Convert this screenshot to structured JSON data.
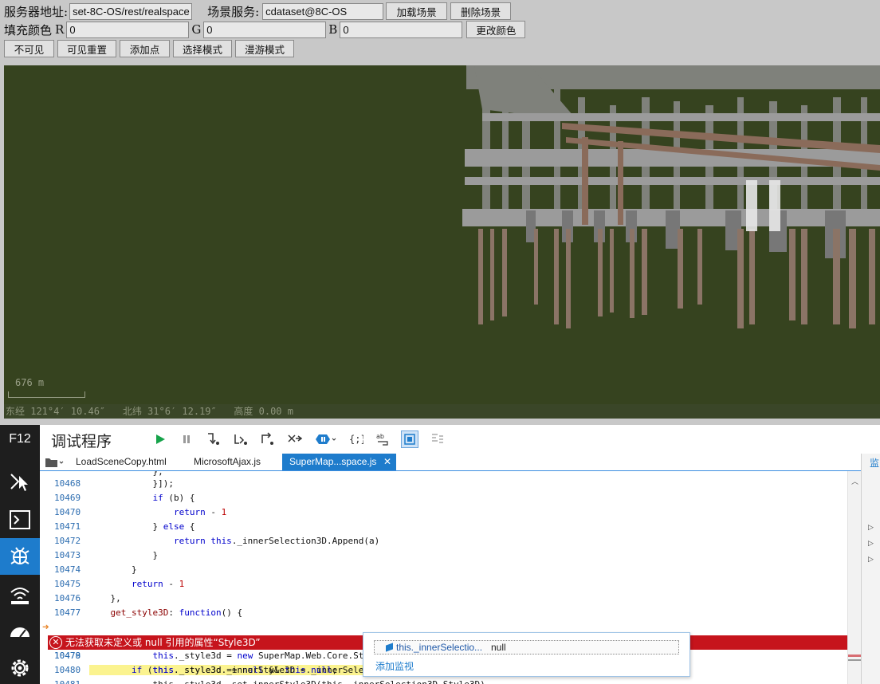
{
  "form": {
    "server_label": "服务器地址:",
    "server_value": "set-8C-OS/rest/realspace",
    "scene_label": "场景服务:",
    "scene_value": "cdataset@8C-OS",
    "load_button": "加载场景",
    "delete_button": "删除场景",
    "fill_label": "填充颜色",
    "r_label": "R",
    "r_value": "0",
    "g_label": "G",
    "g_value": "0",
    "b_label": "B",
    "b_value": "0",
    "change_color_button": "更改颜色",
    "invisible_button": "不可见",
    "reset_visible_button": "可见重置",
    "add_point_button": "添加点",
    "select_mode_button": "选择模式",
    "roam_mode_button": "漫游模式"
  },
  "scene": {
    "scale_text": "676 m",
    "coords_text": "东经 121°4′ 10.46″   北纬 31°6′ 12.19″   高度 0.00 m",
    "background_color": "#36431f"
  },
  "devtools": {
    "f12_label": "F12",
    "title": "调试程序",
    "tabs": [
      {
        "label": "LoadSceneCopy.html"
      },
      {
        "label": "MicrosoftAjax.js"
      },
      {
        "label": "SuperMap...space.js"
      }
    ],
    "rail_icons": [
      "dom-explorer-icon",
      "console-icon",
      "debugger-icon",
      "network-icon",
      "performance-icon",
      "settings-icon"
    ],
    "toolbar_icons": [
      "continue-icon",
      "pause-icon",
      "step-into-icon",
      "step-over-icon",
      "step-out-icon",
      "break-new-worker-icon",
      "exceptions-icon",
      "pretty-print-icon",
      "word-wrap-icon",
      "just-my-code-icon",
      "source-map-icon"
    ],
    "code_lines": [
      {
        "n": "10468",
        "code": "            }]);"
      },
      {
        "n": "10469",
        "code": "            if (b) {"
      },
      {
        "n": "10470",
        "code": "                return - 1"
      },
      {
        "n": "10471",
        "code": "            } else {"
      },
      {
        "n": "10472",
        "code": "                return this._innerSelection3D.Append(a)"
      },
      {
        "n": "10473",
        "code": "            }"
      },
      {
        "n": "10474",
        "code": "        }"
      },
      {
        "n": "10475",
        "code": "        return - 1"
      },
      {
        "n": "10476",
        "code": "    },"
      },
      {
        "n": "10477",
        "code": "    get_style3D: function() {"
      },
      {
        "n": "10478",
        "code": "        if (this._style3d == null && this._innerSelection3D.Style3D != null) {"
      },
      {
        "n": "10479",
        "code": "            this._style3d = new SuperMap.Web.Core.St"
      },
      {
        "n": "10480",
        "code": "            this._style3d._innerStyle3D = null;"
      },
      {
        "n": "10481",
        "code": "            this._style3d._set_innerStyle3D(this._innerSelection3D.Style3D)"
      }
    ],
    "error_message": "无法获取未定义或 null 引用的属性“Style3D”",
    "tooltip": {
      "expression": "this._innerSelectio...",
      "value": "null",
      "add_watch": "添加监视"
    },
    "right_panel_label": "监"
  }
}
